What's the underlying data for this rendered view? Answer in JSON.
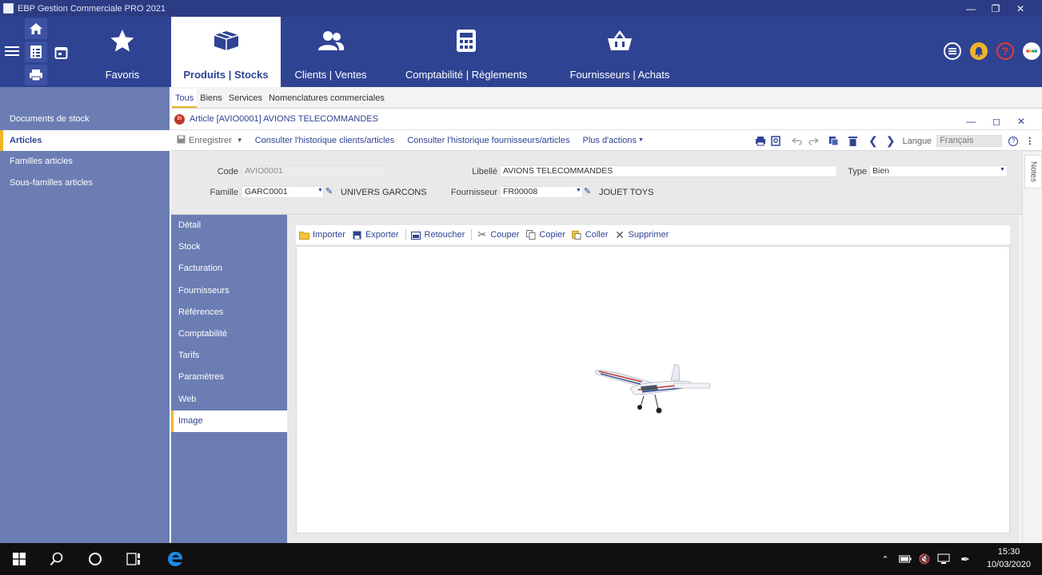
{
  "window": {
    "title": "EBP Gestion Commerciale PRO 2021"
  },
  "ribbon": {
    "tabs": [
      {
        "label": "Favoris",
        "icon": "star-icon"
      },
      {
        "label": "Produits | Stocks",
        "icon": "box-icon"
      },
      {
        "label": "Clients | Ventes",
        "icon": "users-icon"
      },
      {
        "label": "Comptabilité | Règlements",
        "icon": "calculator-icon"
      },
      {
        "label": "Fournisseurs | Achats",
        "icon": "basket-icon"
      }
    ]
  },
  "sidebar": {
    "items": [
      {
        "label": "Documents de stock"
      },
      {
        "label": "Articles"
      },
      {
        "label": "Familles articles"
      },
      {
        "label": "Sous-familles articles"
      }
    ]
  },
  "subtabs": [
    "Tous",
    "Biens",
    "Services",
    "Nomenclatures commerciales"
  ],
  "article": {
    "badge": "BI",
    "title": "Article [AVIO0001] AVIONS TELECOMMANDES"
  },
  "toolbar": {
    "save": "Enregistrer",
    "history_clients": "Consulter l'historique clients/articles",
    "history_suppliers": "Consulter l'historique fournisseurs/articles",
    "more_actions": "Plus d'actions",
    "language_label": "Langue",
    "language_value": "Français"
  },
  "form": {
    "code_label": "Code",
    "code_value": "AVIO0001",
    "libelle_label": "Libellé",
    "libelle_value": "AVIONS TELECOMMANDES",
    "type_label": "Type",
    "type_value": "Bien",
    "famille_label": "Famille",
    "famille_value": "GARC0001",
    "famille_name": "UNIVERS GARCONS",
    "fournisseur_label": "Fournisseur",
    "fournisseur_value": "FR00008",
    "fournisseur_name": "JOUET TOYS"
  },
  "detail_nav": [
    "Détail",
    "Stock",
    "Facturation",
    "Fournisseurs",
    "Références",
    "Comptabilité",
    "Tarifs",
    "Paramètres",
    "Web",
    "Image"
  ],
  "image_tools": [
    "Importer",
    "Exporter",
    "Retoucher",
    "Couper",
    "Copier",
    "Coller",
    "Supprimer"
  ],
  "notes_label": "Notes",
  "taskbar": {
    "time": "15:30",
    "date": "10/03/2020"
  },
  "colors": {
    "ribbon": "#2f4393",
    "sidebar": "#6b7db3",
    "accent": "#f0b429"
  }
}
